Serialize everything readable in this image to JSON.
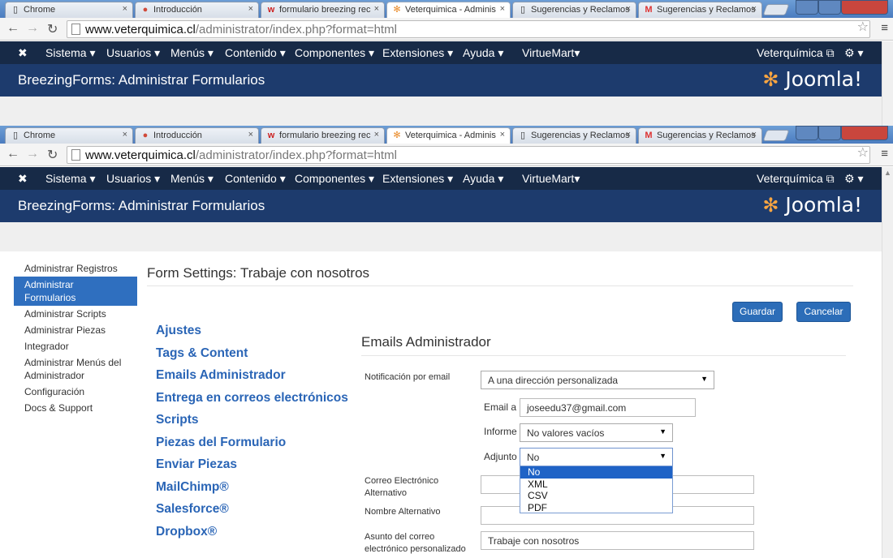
{
  "browser": {
    "tabs": [
      {
        "label": "Chrome",
        "icon": "page-icon",
        "active": false
      },
      {
        "label": "Introducción",
        "icon": "chrome-icon",
        "active": false
      },
      {
        "label": "formulario breezing rec",
        "icon": "w-icon",
        "active": false
      },
      {
        "label": "Veterquimica - Adminis",
        "icon": "joomla-icon",
        "active": true
      },
      {
        "label": "Sugerencias y Reclamos",
        "icon": "page-icon",
        "active": false
      },
      {
        "label": "Sugerencias y Reclamos",
        "icon": "gmail-icon",
        "active": false
      }
    ],
    "url_host": "www.veterquimica.cl",
    "url_path": "/administrator/index.php?format=html"
  },
  "joomla_nav": {
    "items": [
      "Sistema ▾",
      "Usuarios ▾",
      "Menús ▾",
      "Contenido ▾",
      "Componentes ▾",
      "Extensiones ▾",
      "Ayuda ▾",
      "VirtueMart▾"
    ],
    "site_link": "Veterquímica ⧉",
    "settings": "⚙ ▾"
  },
  "header": {
    "title": "BreezingForms: Administrar Formularios",
    "logo": "Joomla!"
  },
  "sidebar": {
    "items": [
      {
        "label": "Administrar Registros",
        "active": false
      },
      {
        "label": "Administrar Formularios",
        "active": true
      },
      {
        "label": "Administrar Scripts",
        "active": false
      },
      {
        "label": "Administrar Piezas",
        "active": false
      },
      {
        "label": "Integrador",
        "active": false
      },
      {
        "label": "Administrar Menús del Administrador",
        "active": false
      },
      {
        "label": "Configuración",
        "active": false
      },
      {
        "label": "Docs & Support",
        "active": false
      }
    ]
  },
  "form": {
    "title": "Form Settings: Trabaje con nosotros",
    "save_label": "Guardar",
    "cancel_label": "Cancelar",
    "sections": [
      "Ajustes",
      "Tags & Content",
      "Emails Administrador",
      "Entrega en correos electrónicos",
      "Scripts",
      "Piezas del Formulario",
      "Enviar Piezas",
      "MailChimp®",
      "Salesforce®",
      "Dropbox®"
    ],
    "panel_title": "Emails Administrador",
    "notify_label": "Notificación por email",
    "notify_value": "A una dirección personalizada",
    "email_label": "Email a",
    "email_value": "joseedu37@gmail.com",
    "report_label": "Informe",
    "report_value": "No valores vacíos",
    "attach_label": "Adjunto",
    "attach_value": "No",
    "attach_options": [
      "No",
      "XML",
      "CSV",
      "PDF"
    ],
    "alt_email_label": "Correo Electrónico Alternativo",
    "alt_name_label": "Nombre Alternativo",
    "subject_label": "Asunto del correo electrónico personalizado",
    "subject_value": "Trabaje con nosotros"
  },
  "colors": {
    "nav_bg": "#172a47",
    "header_bg": "#1d3b6d",
    "accent": "#2c6db8",
    "link": "#2a65b6"
  }
}
